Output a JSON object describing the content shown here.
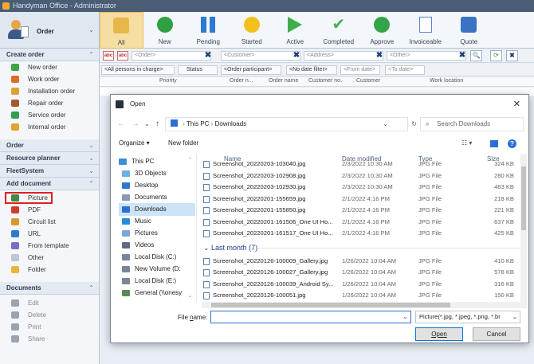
{
  "window": {
    "title": "Handyman Office - Administrator"
  },
  "user": {
    "label": "Order"
  },
  "ribbon": {
    "buttons": [
      {
        "label": "All",
        "color": "#e6b84a",
        "active": true,
        "icon": "clipboard-icon"
      },
      {
        "label": "New",
        "color": "#2ea043",
        "active": false,
        "icon": "plus-circle-icon"
      },
      {
        "label": "Pending",
        "color": "#2b7bd4",
        "active": false,
        "icon": "pause-icon"
      },
      {
        "label": "Started",
        "color": "#f2c21b",
        "active": false,
        "icon": "circle-icon"
      },
      {
        "label": "Active",
        "color": "#3fae49",
        "active": false,
        "icon": "play-icon"
      },
      {
        "label": "Completed",
        "color": "#48b24a",
        "active": false,
        "icon": "checkmark-icon"
      },
      {
        "label": "Approve",
        "color": "#33a447",
        "active": false,
        "icon": "check-circle-icon"
      },
      {
        "label": "Invoiceable",
        "color": "#5a86c8",
        "active": false,
        "icon": "invoice-icon"
      },
      {
        "label": "Quote",
        "color": "#3a73c4",
        "active": false,
        "icon": "calculator-icon"
      }
    ]
  },
  "filters": {
    "row1": {
      "abc1": "abc",
      "abc2": "abc",
      "order": "<Order>",
      "customer": "<Customer>",
      "address": "<Address>",
      "other": "<Other>"
    },
    "row2": {
      "persons": "<All persons in charge>",
      "status": "Status",
      "participant": "<Order participant>",
      "date_filter": "<No date filter>",
      "from_date": "<From date>",
      "to_date": "<To date>"
    }
  },
  "table": {
    "headers": [
      "Priority",
      "Order n...",
      "Order name",
      "Customer no.",
      "Customer",
      "Work location"
    ]
  },
  "sidebar": {
    "create_order": {
      "title": "Create order",
      "items": [
        {
          "label": "New order",
          "color": "#3aa648",
          "icon": "plus-icon"
        },
        {
          "label": "Work order",
          "color": "#e26b2c",
          "icon": "work-order-icon"
        },
        {
          "label": "Installation order",
          "color": "#d8a43a",
          "icon": "wrench-icon"
        },
        {
          "label": "Repair order",
          "color": "#a05a2c",
          "icon": "repair-icon"
        },
        {
          "label": "Service order",
          "color": "#2f9e52",
          "icon": "service-icon"
        },
        {
          "label": "Internal order",
          "color": "#e3a330",
          "icon": "internal-icon"
        }
      ]
    },
    "order": {
      "title": "Order"
    },
    "resource_planner": {
      "title": "Resource planner"
    },
    "fleetsystem": {
      "title": "FleetSystem"
    },
    "add_document": {
      "title": "Add document",
      "items": [
        {
          "label": "Picture",
          "color": "#3f8a3f",
          "icon": "picture-icon",
          "selected": true
        },
        {
          "label": "PDF",
          "color": "#d33b2c",
          "icon": "pdf-icon"
        },
        {
          "label": "Circuit list",
          "color": "#d39a34",
          "icon": "circuit-list-icon"
        },
        {
          "label": "URL",
          "color": "#2f7ad0",
          "icon": "globe-icon"
        },
        {
          "label": "From template",
          "color": "#7a6cc0",
          "icon": "template-icon"
        },
        {
          "label": "Other",
          "color": "#bfc6cf",
          "icon": "document-icon"
        },
        {
          "label": "Folder",
          "color": "#e8b53a",
          "icon": "folder-icon"
        }
      ]
    },
    "documents": {
      "title": "Documents",
      "items": [
        {
          "label": "Edit",
          "color": "#9aa4b0",
          "icon": "edit-icon"
        },
        {
          "label": "Delete",
          "color": "#9aa4b0",
          "icon": "delete-icon"
        },
        {
          "label": "Print",
          "color": "#9aa4b0",
          "icon": "print-icon"
        },
        {
          "label": "Share",
          "color": "#9aa4b0",
          "icon": "share-icon"
        }
      ]
    }
  },
  "dialog": {
    "title": "Open",
    "path": [
      "This PC",
      "Downloads"
    ],
    "search_placeholder": "Search Downloads",
    "organize": "Organize ▾",
    "new_folder": "New folder",
    "nav_items": [
      {
        "label": "This PC",
        "color": "#3a8fd6",
        "icon": "computer-icon"
      },
      {
        "label": "3D Objects",
        "color": "#6bb0e8",
        "icon": "cube-icon"
      },
      {
        "label": "Desktop",
        "color": "#2a7bd0",
        "icon": "desktop-icon"
      },
      {
        "label": "Documents",
        "color": "#8a99b0",
        "icon": "documents-icon"
      },
      {
        "label": "Downloads",
        "color": "#2b6fd6",
        "icon": "download-icon",
        "selected": true
      },
      {
        "label": "Music",
        "color": "#2b8ad6",
        "icon": "music-icon"
      },
      {
        "label": "Pictures",
        "color": "#7da6d8",
        "icon": "pictures-icon"
      },
      {
        "label": "Videos",
        "color": "#5a6a80",
        "icon": "videos-icon"
      },
      {
        "label": "Local Disk (C:)",
        "color": "#7a8696",
        "icon": "drive-icon"
      },
      {
        "label": "New Volume (D:",
        "color": "#7a8696",
        "icon": "drive-icon"
      },
      {
        "label": "Local Disk (E:)",
        "color": "#7a8696",
        "icon": "drive-icon"
      },
      {
        "label": "General (\\\\onesy",
        "color": "#5a8a5a",
        "icon": "network-drive-icon"
      }
    ],
    "columns": {
      "name": "Name",
      "date": "Date modified",
      "type": "Type",
      "size": "Size"
    },
    "files_recent": [
      {
        "name": "Screenshot_20220203-103040.jpg",
        "date": "2/3/2022 10:30 AM",
        "type": "JPG File",
        "size": "324 KB"
      },
      {
        "name": "Screenshot_20220203-102908.jpg",
        "date": "2/3/2022 10:30 AM",
        "type": "JPG File",
        "size": "280 KB"
      },
      {
        "name": "Screenshot_20220203-102930.jpg",
        "date": "2/3/2022 10:30 AM",
        "type": "JPG File",
        "size": "483 KB"
      },
      {
        "name": "Screenshot_20220201-155659.jpg",
        "date": "2/1/2022 4:16 PM",
        "type": "JPG File",
        "size": "218 KB"
      },
      {
        "name": "Screenshot_20220201-155850.jpg",
        "date": "2/1/2022 4:16 PM",
        "type": "JPG File",
        "size": "221 KB"
      },
      {
        "name": "Screenshot_20220201-161506_One UI Ho...",
        "date": "2/1/2022 4:16 PM",
        "type": "JPG File",
        "size": "637 KB"
      },
      {
        "name": "Screenshot_20220201-161517_One UI Ho...",
        "date": "2/1/2022 4:16 PM",
        "type": "JPG File",
        "size": "425 KB"
      }
    ],
    "group_last_month": "Last month (7)",
    "files_last_month": [
      {
        "name": "Screenshot_20220126-100009_Gallery.jpg",
        "date": "1/26/2022 10:04 AM",
        "type": "JPG File",
        "size": "410 KB"
      },
      {
        "name": "Screenshot_20220126-100027_Gallery.jpg",
        "date": "1/26/2022 10:04 AM",
        "type": "JPG File",
        "size": "578 KB"
      },
      {
        "name": "Screenshot_20220126-100039_Android Sy...",
        "date": "1/26/2022 10:04 AM",
        "type": "JPG File",
        "size": "316 KB"
      },
      {
        "name": "Screenshot_20220126-100051.jpg",
        "date": "1/26/2022 10:04 AM",
        "type": "JPG File",
        "size": "150 KB"
      }
    ],
    "file_name_label_pre": "File ",
    "file_name_label_u": "n",
    "file_name_label_post": "ame:",
    "file_name_value": "",
    "file_type": "Picture(*.jpg, *.jpeg, *.png, *.br",
    "open_label": "Open",
    "cancel_label": "Cancel"
  }
}
